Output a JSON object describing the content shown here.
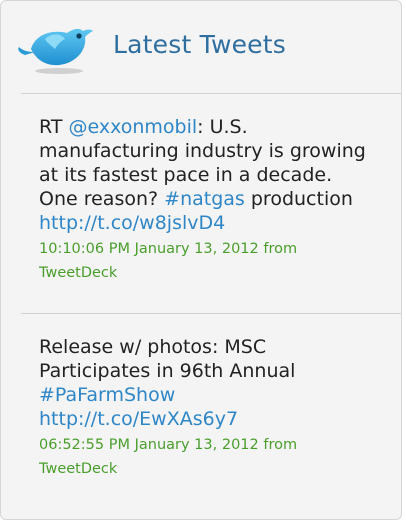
{
  "widget": {
    "title": "Latest Tweets",
    "icon": "twitter-bird-icon",
    "colors": {
      "title": "#2f6fa0",
      "link": "#2f86c7",
      "meta": "#4a9e2c",
      "background": "#f4f4f4"
    }
  },
  "tweets": [
    {
      "parts": {
        "prefix": "RT ",
        "mention": "@exxonmobil",
        "body": ": U.S. manufacturing industry is growing at its fastest pace in a decade. One reason? ",
        "hashtag": "#natgas",
        "mid": " production ",
        "link": "http://t.co/w8jslvD4"
      },
      "timestamp": "10:10:06 PM January 13, 2012",
      "from_label": "from",
      "source": "TweetDeck"
    },
    {
      "parts": {
        "body": "Release w/ photos: MSC Participates in 96th Annual ",
        "hashtag": "#PaFarmShow",
        "link": "http://t.co/EwXAs6y7"
      },
      "timestamp": "06:52:55 PM January 13, 2012",
      "from_label": "from",
      "source": "TweetDeck"
    }
  ]
}
